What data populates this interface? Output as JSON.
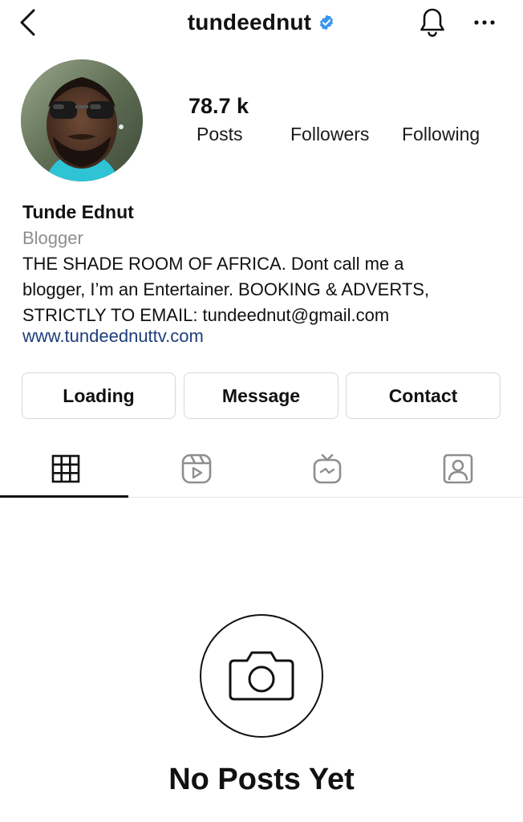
{
  "header": {
    "username": "tundeednut",
    "back_icon": "chevron-left-icon",
    "verified_icon": "verified-badge-icon",
    "bell_icon": "bell-icon",
    "more_icon": "more-horizontal-icon",
    "verified_color": "#3897f0"
  },
  "profile": {
    "avatar_icon": "profile-photo",
    "stats": {
      "posts_count": "78.7 k",
      "posts_label": "Posts",
      "followers_label": "Followers",
      "following_label": "Following"
    },
    "name": "Tunde Ednut",
    "category": "Blogger",
    "bio_lines": [
      "THE SHADE ROOM OF AFRICA. Dont call me a",
      "blogger, I’m an Entertainer. BOOKING & ADVERTS,",
      "STRICTLY TO EMAIL: tundeednut@gmail.com"
    ],
    "website": "www.tundeednuttv.com",
    "link_color": "#1d3e7a"
  },
  "actions": {
    "loading_label": "Loading",
    "message_label": "Message",
    "contact_label": "Contact"
  },
  "tabs": [
    {
      "icon": "grid-icon",
      "active": true
    },
    {
      "icon": "reels-icon",
      "active": false
    },
    {
      "icon": "igtv-icon",
      "active": false
    },
    {
      "icon": "tagged-icon",
      "active": false
    }
  ],
  "empty_state": {
    "icon": "camera-icon",
    "title": "No Posts Yet"
  }
}
